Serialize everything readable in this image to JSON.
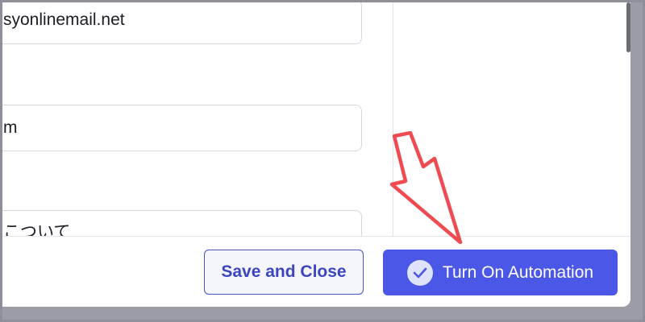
{
  "fields": {
    "email_value": "syonlinemail.net",
    "second_value": "m",
    "third_value": "こついて"
  },
  "footer": {
    "save_close_label": "Save and Close",
    "turn_on_label": "Turn On Automation"
  },
  "icons": {
    "check": "check-circle-icon",
    "annotation_arrow": "arrow-pointer-annotation"
  },
  "colors": {
    "primary": "#4b57e6",
    "secondary_text": "#3c46bf",
    "annotation": "#ef4b52"
  }
}
